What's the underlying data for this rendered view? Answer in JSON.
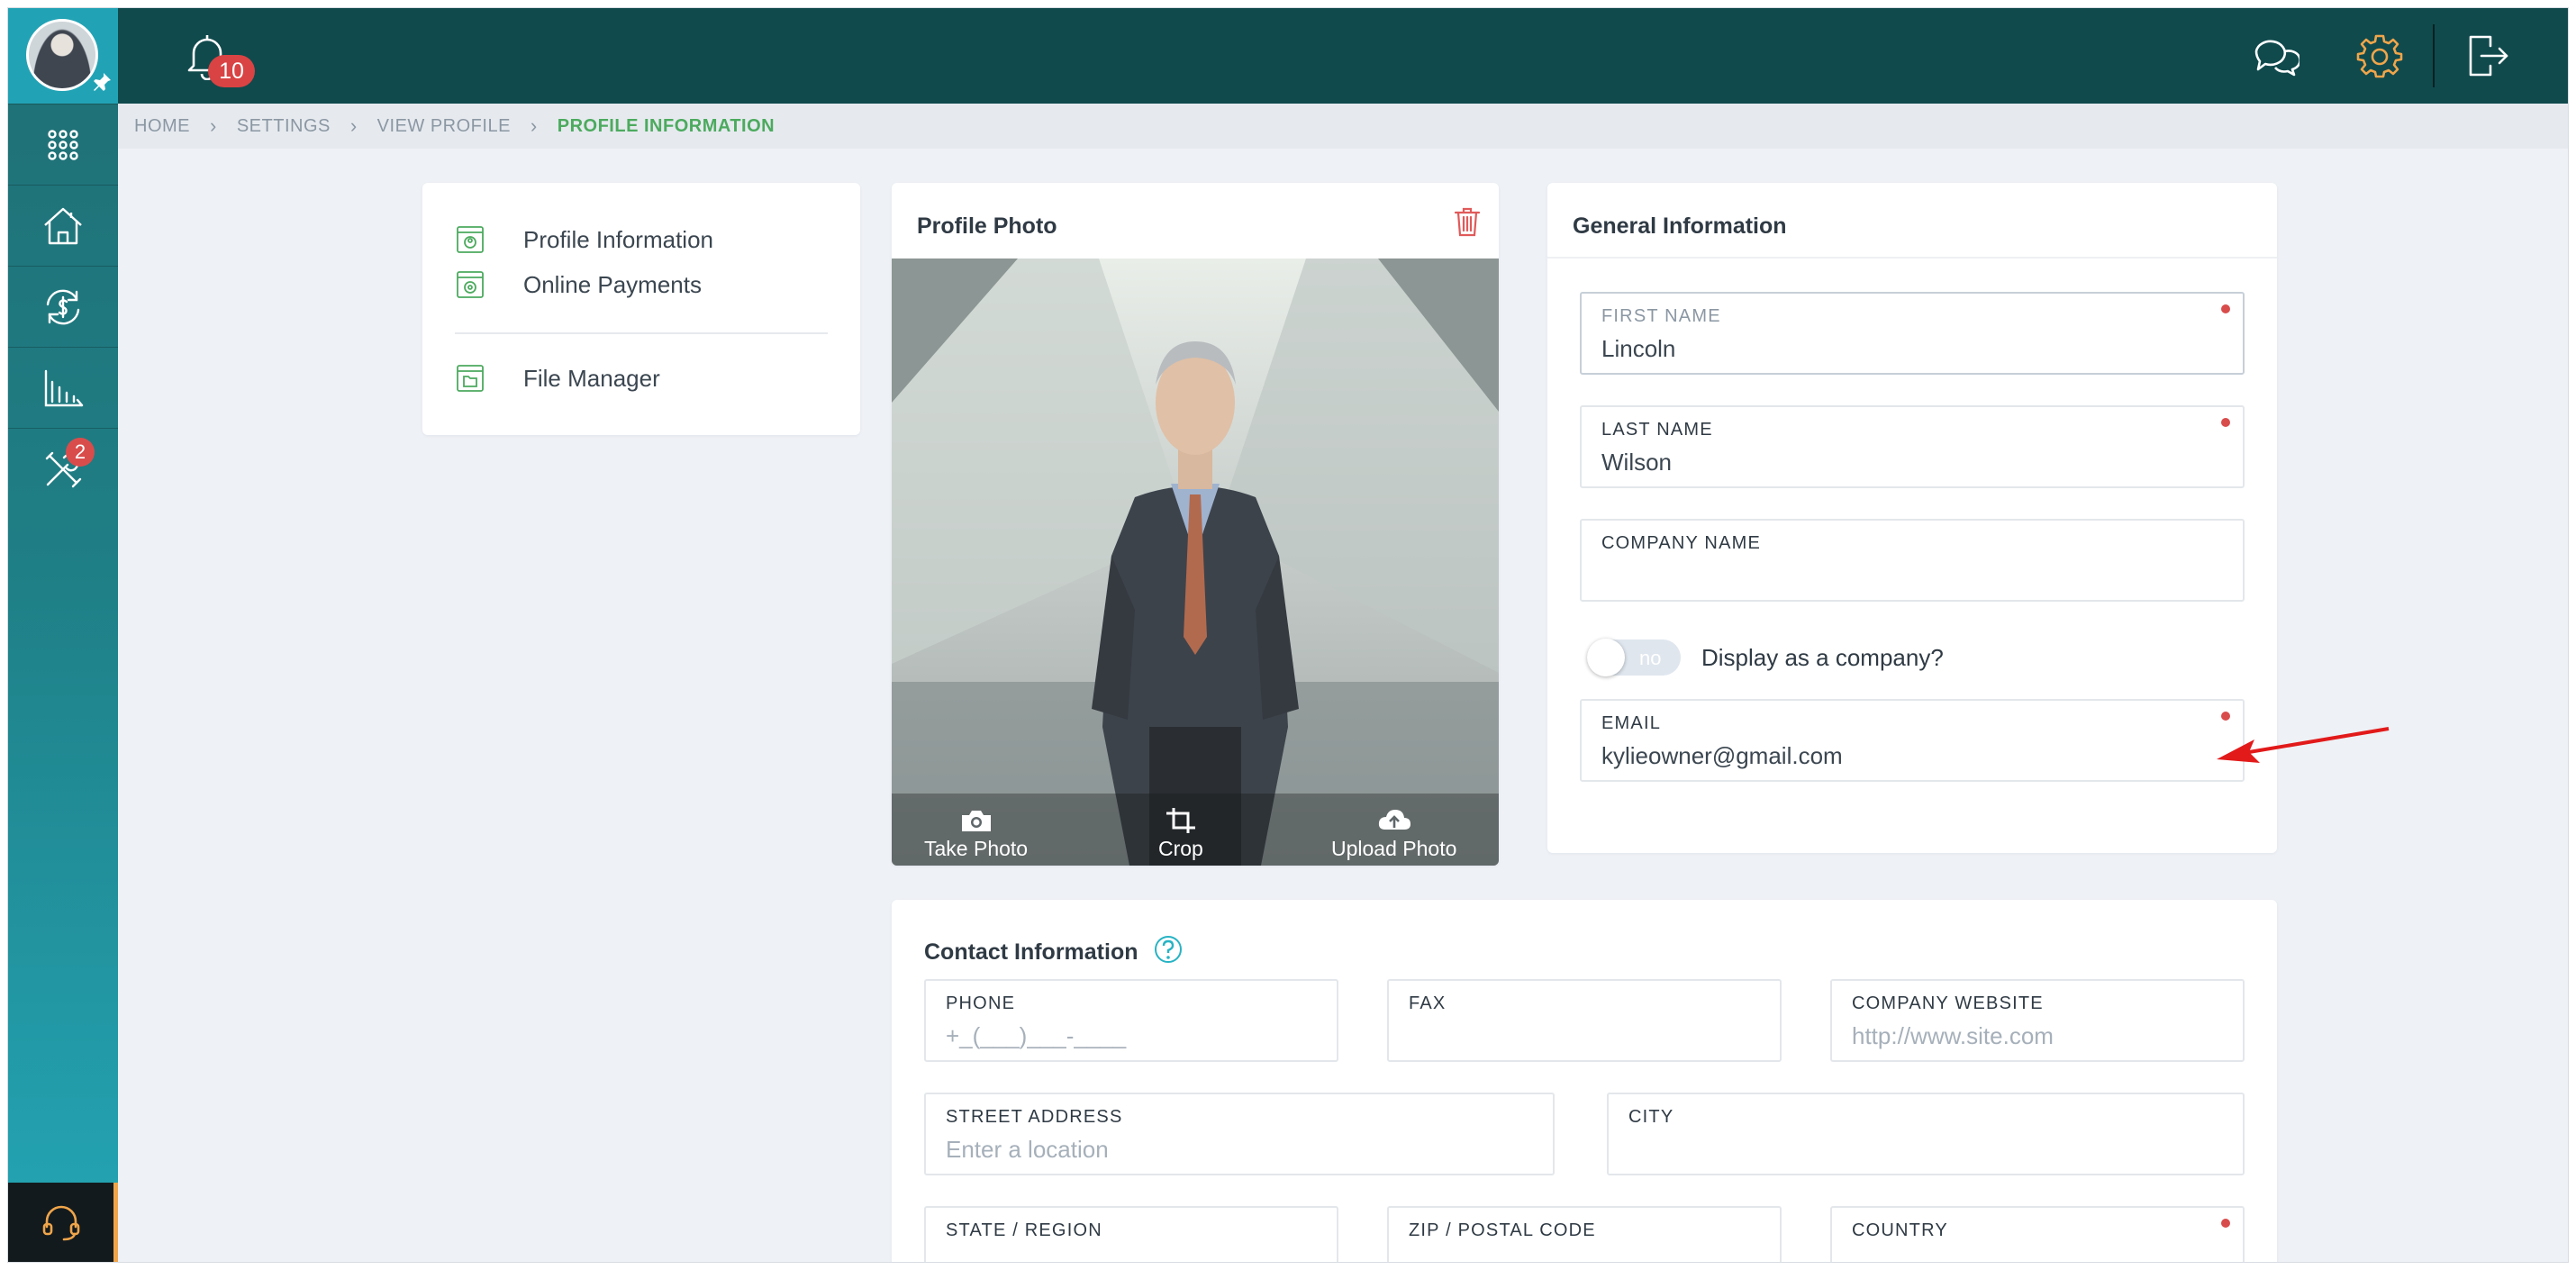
{
  "topbar": {
    "notification_count": "10"
  },
  "sidebar": {
    "tools_badge": "2"
  },
  "breadcrumb": [
    "HOME",
    "SETTINGS",
    "VIEW PROFILE",
    "PROFILE INFORMATION"
  ],
  "menu": {
    "items": [
      "Profile Information",
      "Online Payments",
      "File Manager"
    ]
  },
  "photo_card": {
    "title": "Profile Photo",
    "actions": [
      "Take Photo",
      "Crop",
      "Upload Photo"
    ]
  },
  "general": {
    "title": "General Information",
    "first_name": {
      "label": "FIRST NAME",
      "value": "Lincoln"
    },
    "last_name": {
      "label": "LAST NAME",
      "value": "Wilson"
    },
    "company_name": {
      "label": "COMPANY NAME",
      "value": ""
    },
    "toggle": {
      "state": "no",
      "label": "Display as a company?"
    },
    "email": {
      "label": "EMAIL",
      "value": "kylieowner@gmail.com"
    }
  },
  "contact": {
    "title": "Contact Information",
    "phone": {
      "label": "PHONE",
      "placeholder": "+_(___)___-____"
    },
    "fax": {
      "label": "FAX",
      "placeholder": ""
    },
    "website": {
      "label": "COMPANY WEBSITE",
      "placeholder": "http://www.site.com"
    },
    "street": {
      "label": "STREET ADDRESS",
      "placeholder": "Enter a location"
    },
    "city": {
      "label": "CITY",
      "placeholder": ""
    },
    "state": {
      "label": "STATE / REGION"
    },
    "zip": {
      "label": "ZIP / POSTAL CODE"
    },
    "country": {
      "label": "COUNTRY"
    }
  },
  "colors": {
    "topbar": "#104a4d",
    "sidebar": "#1f7f86",
    "accent_green": "#4caa5e",
    "required": "#d94c4c",
    "gear": "#f0a54a"
  }
}
